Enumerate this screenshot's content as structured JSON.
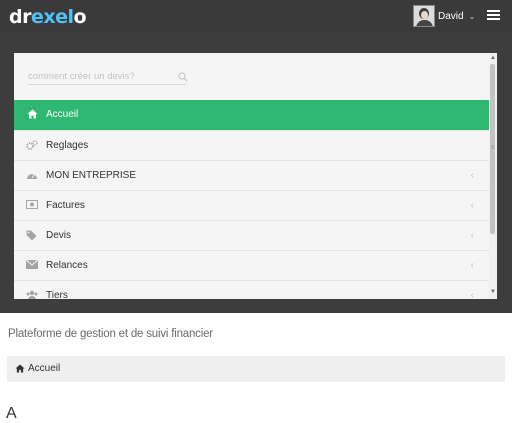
{
  "header": {
    "logo_part1": "dr",
    "logo_part2": "exel",
    "logo_part3": "o",
    "user_name": "David",
    "colors": {
      "bar": "#3a3a3a",
      "logo_accent": "#4fc3f7"
    }
  },
  "search": {
    "placeholder": "comment créer un devis?",
    "icon": "search-icon"
  },
  "menu": {
    "items": [
      {
        "label": "Accueil",
        "icon": "home-icon",
        "active": true,
        "has_chevron": false
      },
      {
        "label": "Reglages",
        "icon": "cogs-icon",
        "active": false,
        "has_chevron": false
      },
      {
        "label": "MON ENTREPRISE",
        "icon": "dashboard-icon",
        "active": false,
        "has_chevron": true
      },
      {
        "label": "Factures",
        "icon": "money-icon",
        "active": false,
        "has_chevron": true
      },
      {
        "label": "Devis",
        "icon": "tags-icon",
        "active": false,
        "has_chevron": true
      },
      {
        "label": "Relances",
        "icon": "envelope-icon",
        "active": false,
        "has_chevron": true
      },
      {
        "label": "Tiers",
        "icon": "users-icon",
        "active": false,
        "has_chevron": true
      }
    ],
    "active_color": "#2eb872"
  },
  "page": {
    "subtitle": "Plateforme de gestion et de suivi financier",
    "breadcrumb": "Accueil",
    "heading_fragment": "A"
  }
}
